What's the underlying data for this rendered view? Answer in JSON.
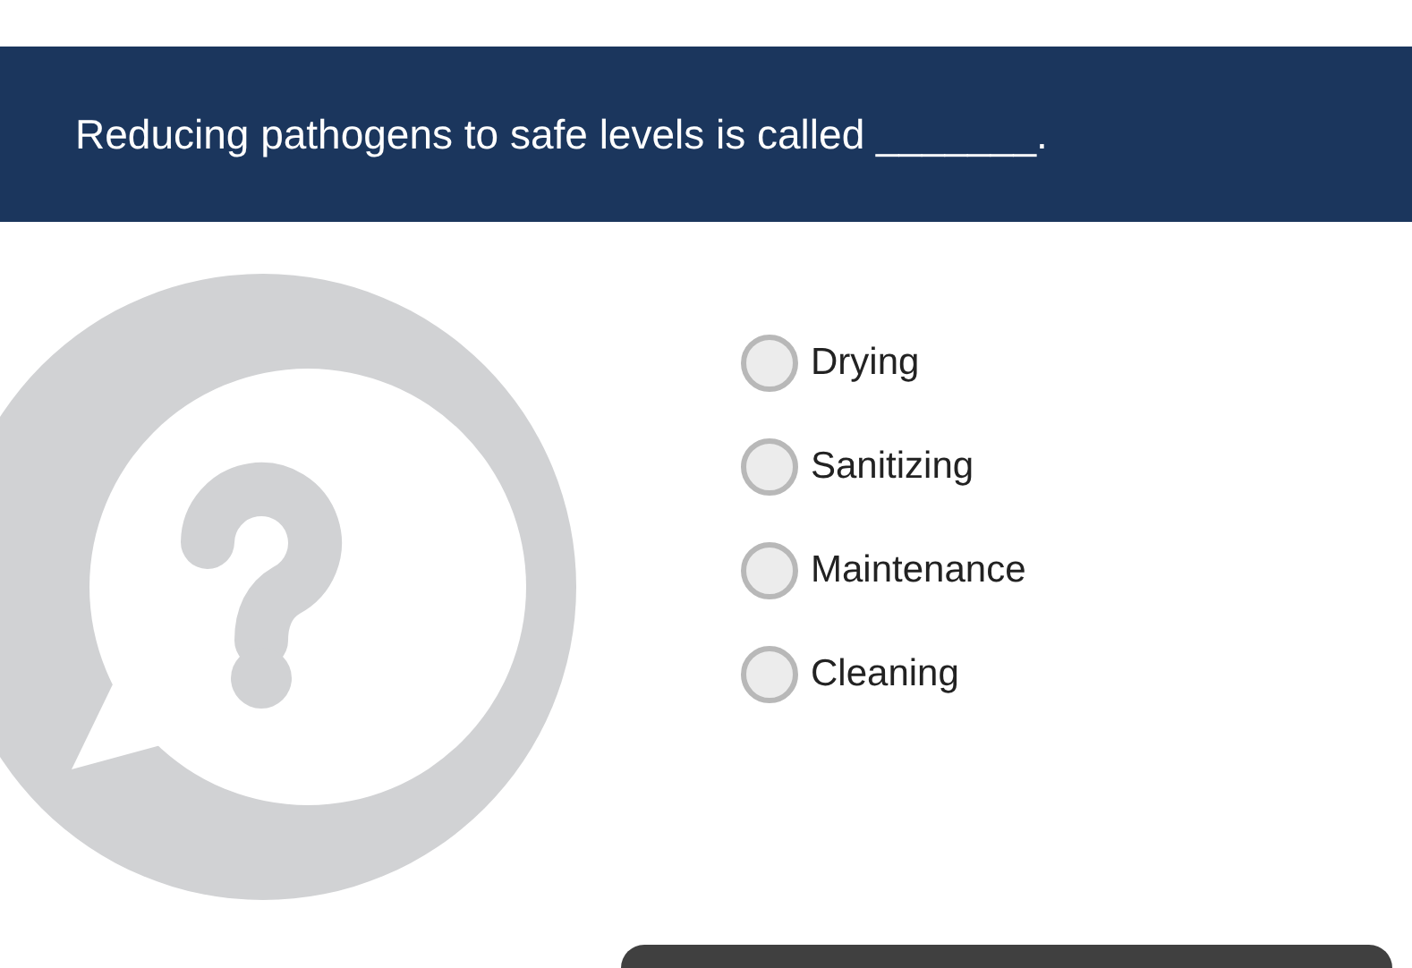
{
  "question": "Reducing pathogens to safe levels is called _______.",
  "options": [
    {
      "label": "Drying",
      "selected": false
    },
    {
      "label": "Sanitizing",
      "selected": false
    },
    {
      "label": "Maintenance",
      "selected": false
    },
    {
      "label": "Cleaning",
      "selected": false
    }
  ]
}
